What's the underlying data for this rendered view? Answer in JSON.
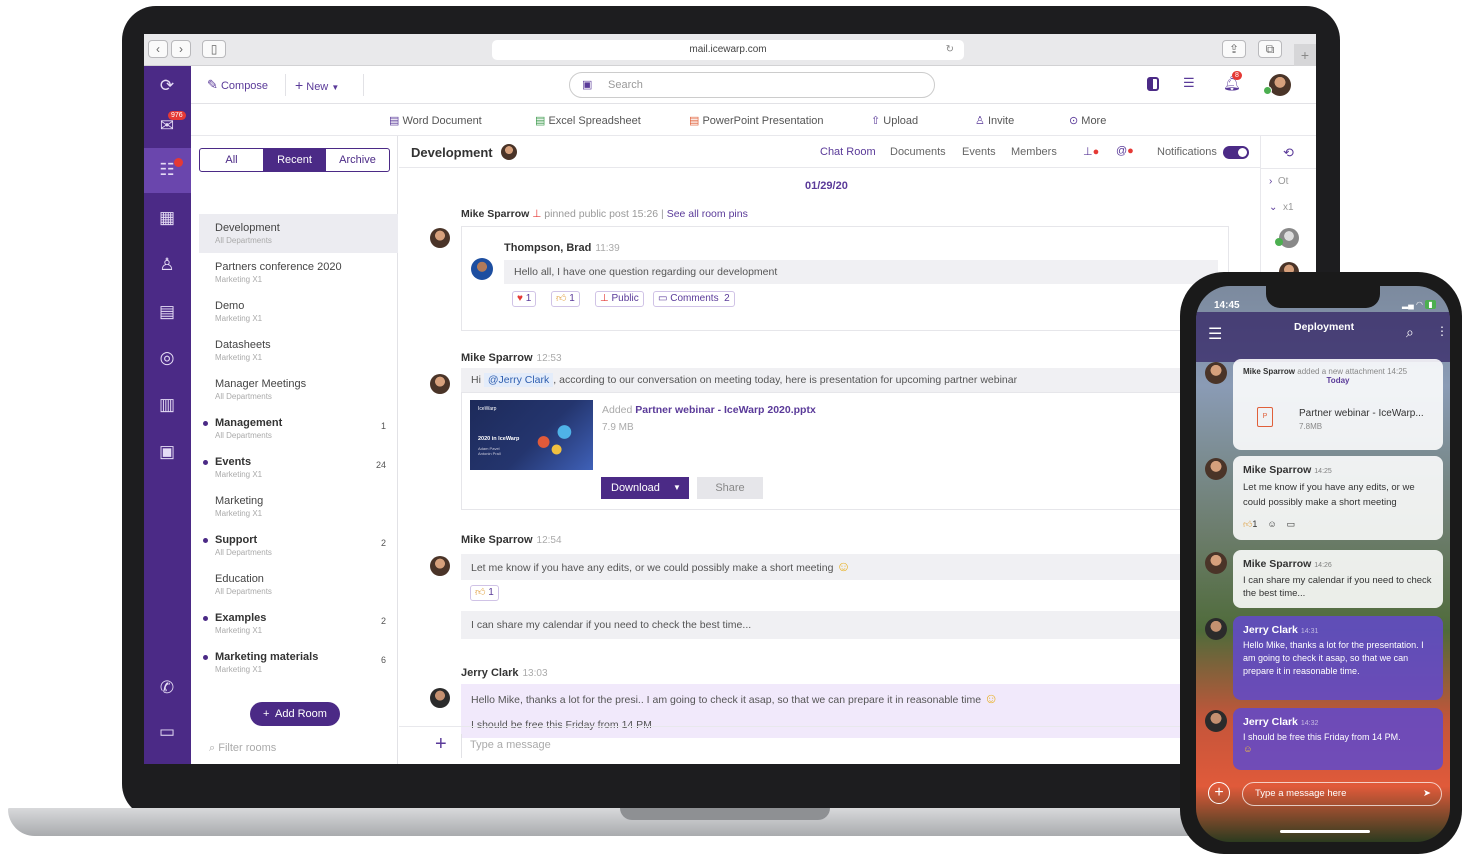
{
  "browser": {
    "url": "mail.icewarp.com"
  },
  "leftbar": {
    "mail_badge": "976"
  },
  "topbar": {
    "compose": "Compose",
    "new": "New",
    "search_placeholder": "Search",
    "notif_badge": "8"
  },
  "docbar": {
    "items": [
      "Word Document",
      "Excel Spreadsheet",
      "PowerPoint Presentation",
      "Upload",
      "Invite",
      "More"
    ]
  },
  "rooms": {
    "tabs": [
      "All",
      "Recent",
      "Archive"
    ],
    "items": [
      {
        "name": "Development",
        "sub": "All Departments",
        "count": ""
      },
      {
        "name": "Partners conference 2020",
        "sub": "Marketing X1",
        "count": ""
      },
      {
        "name": "Demo",
        "sub": "Marketing X1",
        "count": ""
      },
      {
        "name": "Datasheets",
        "sub": "Marketing X1",
        "count": ""
      },
      {
        "name": "Manager Meetings",
        "sub": "All Departments",
        "count": ""
      },
      {
        "name": "Management",
        "sub": "All Departments",
        "count": "1"
      },
      {
        "name": "Events",
        "sub": "Marketing X1",
        "count": "24"
      },
      {
        "name": "Marketing",
        "sub": "Marketing X1",
        "count": ""
      },
      {
        "name": "Support",
        "sub": "All Departments",
        "count": "2"
      },
      {
        "name": "Education",
        "sub": "All Departments",
        "count": ""
      },
      {
        "name": "Examples",
        "sub": "Marketing X1",
        "count": "2"
      },
      {
        "name": "Marketing materials",
        "sub": "Marketing X1",
        "count": "6"
      }
    ],
    "add_room": "Add Room",
    "filter_placeholder": "Filter rooms"
  },
  "chat": {
    "title": "Development",
    "tabs": [
      "Chat Room",
      "Documents",
      "Events",
      "Members"
    ],
    "notifications": "Notifications",
    "date": "01/29/20",
    "pin": {
      "user": "Mike Sparrow",
      "text": "pinned public post 15:26",
      "link": "See all room pins"
    },
    "pinned": {
      "user": "Thompson, Brad",
      "time": "11:39",
      "text": "Hello all, I have one question regarding our development",
      "r1": "1",
      "r2": "1",
      "public": "Public",
      "comments": "Comments",
      "comments_count": "2"
    },
    "m1": {
      "user": "Mike Sparrow",
      "time": "12:53",
      "pre": "Hi",
      "mention": "@Jerry Clark",
      "text": ", according to our conversation on meeting today, here is presentation for upcoming partner webinar",
      "added": "Added",
      "file": "Partner webinar - IceWarp 2020.pptx",
      "size": "7.9 MB",
      "download": "Download",
      "share": "Share",
      "thumb_title": "2020 in IceWarp",
      "thumb_sub": "Adam Pavel\nAntonin Prall",
      "thumb_logo": "IceWarp"
    },
    "m2": {
      "user": "Mike Sparrow",
      "time": "12:54",
      "text": "Let me know if you have any edits, or we could possibly make a short meeting",
      "r": "1",
      "text2": "I can share my calendar if you need to check the best time..."
    },
    "m3": {
      "user": "Jerry Clark",
      "time": "13:03",
      "text": "Hello Mike, thanks a lot for the presi.. I am going to check it asap, so that we can prepare it in reasonable time",
      "text2": "I should be free this Friday from 14 PM"
    },
    "input_placeholder": "Type a message"
  },
  "rail": {
    "r1": "Ot",
    "r2": "x1"
  },
  "phone": {
    "time": "14:45",
    "title": "Deployment",
    "c1": {
      "user": "Mike Sparrow",
      "text": "added a new attachment",
      "time": "14:25",
      "today": "Today",
      "file": "Partner webinar - IceWarp...",
      "size": "7.8MB"
    },
    "c2": {
      "user": "Mike Sparrow",
      "time": "14:25",
      "text": "Let me know if you have any edits, or we could possibly make a short meeting",
      "r": "1"
    },
    "c3": {
      "user": "Mike Sparrow",
      "time": "14:26",
      "text": "I can share my calendar if you need to check the best time..."
    },
    "c4": {
      "user": "Jerry Clark",
      "time": "14:31",
      "text": "Hello Mike, thanks a lot for the presentation. I am going to check it asap, so that we can prepare it in reasonable time."
    },
    "c5": {
      "user": "Jerry Clark",
      "time": "14:32",
      "text": "I should be free this Friday from 14 PM."
    },
    "input_placeholder": "Type a message here"
  }
}
